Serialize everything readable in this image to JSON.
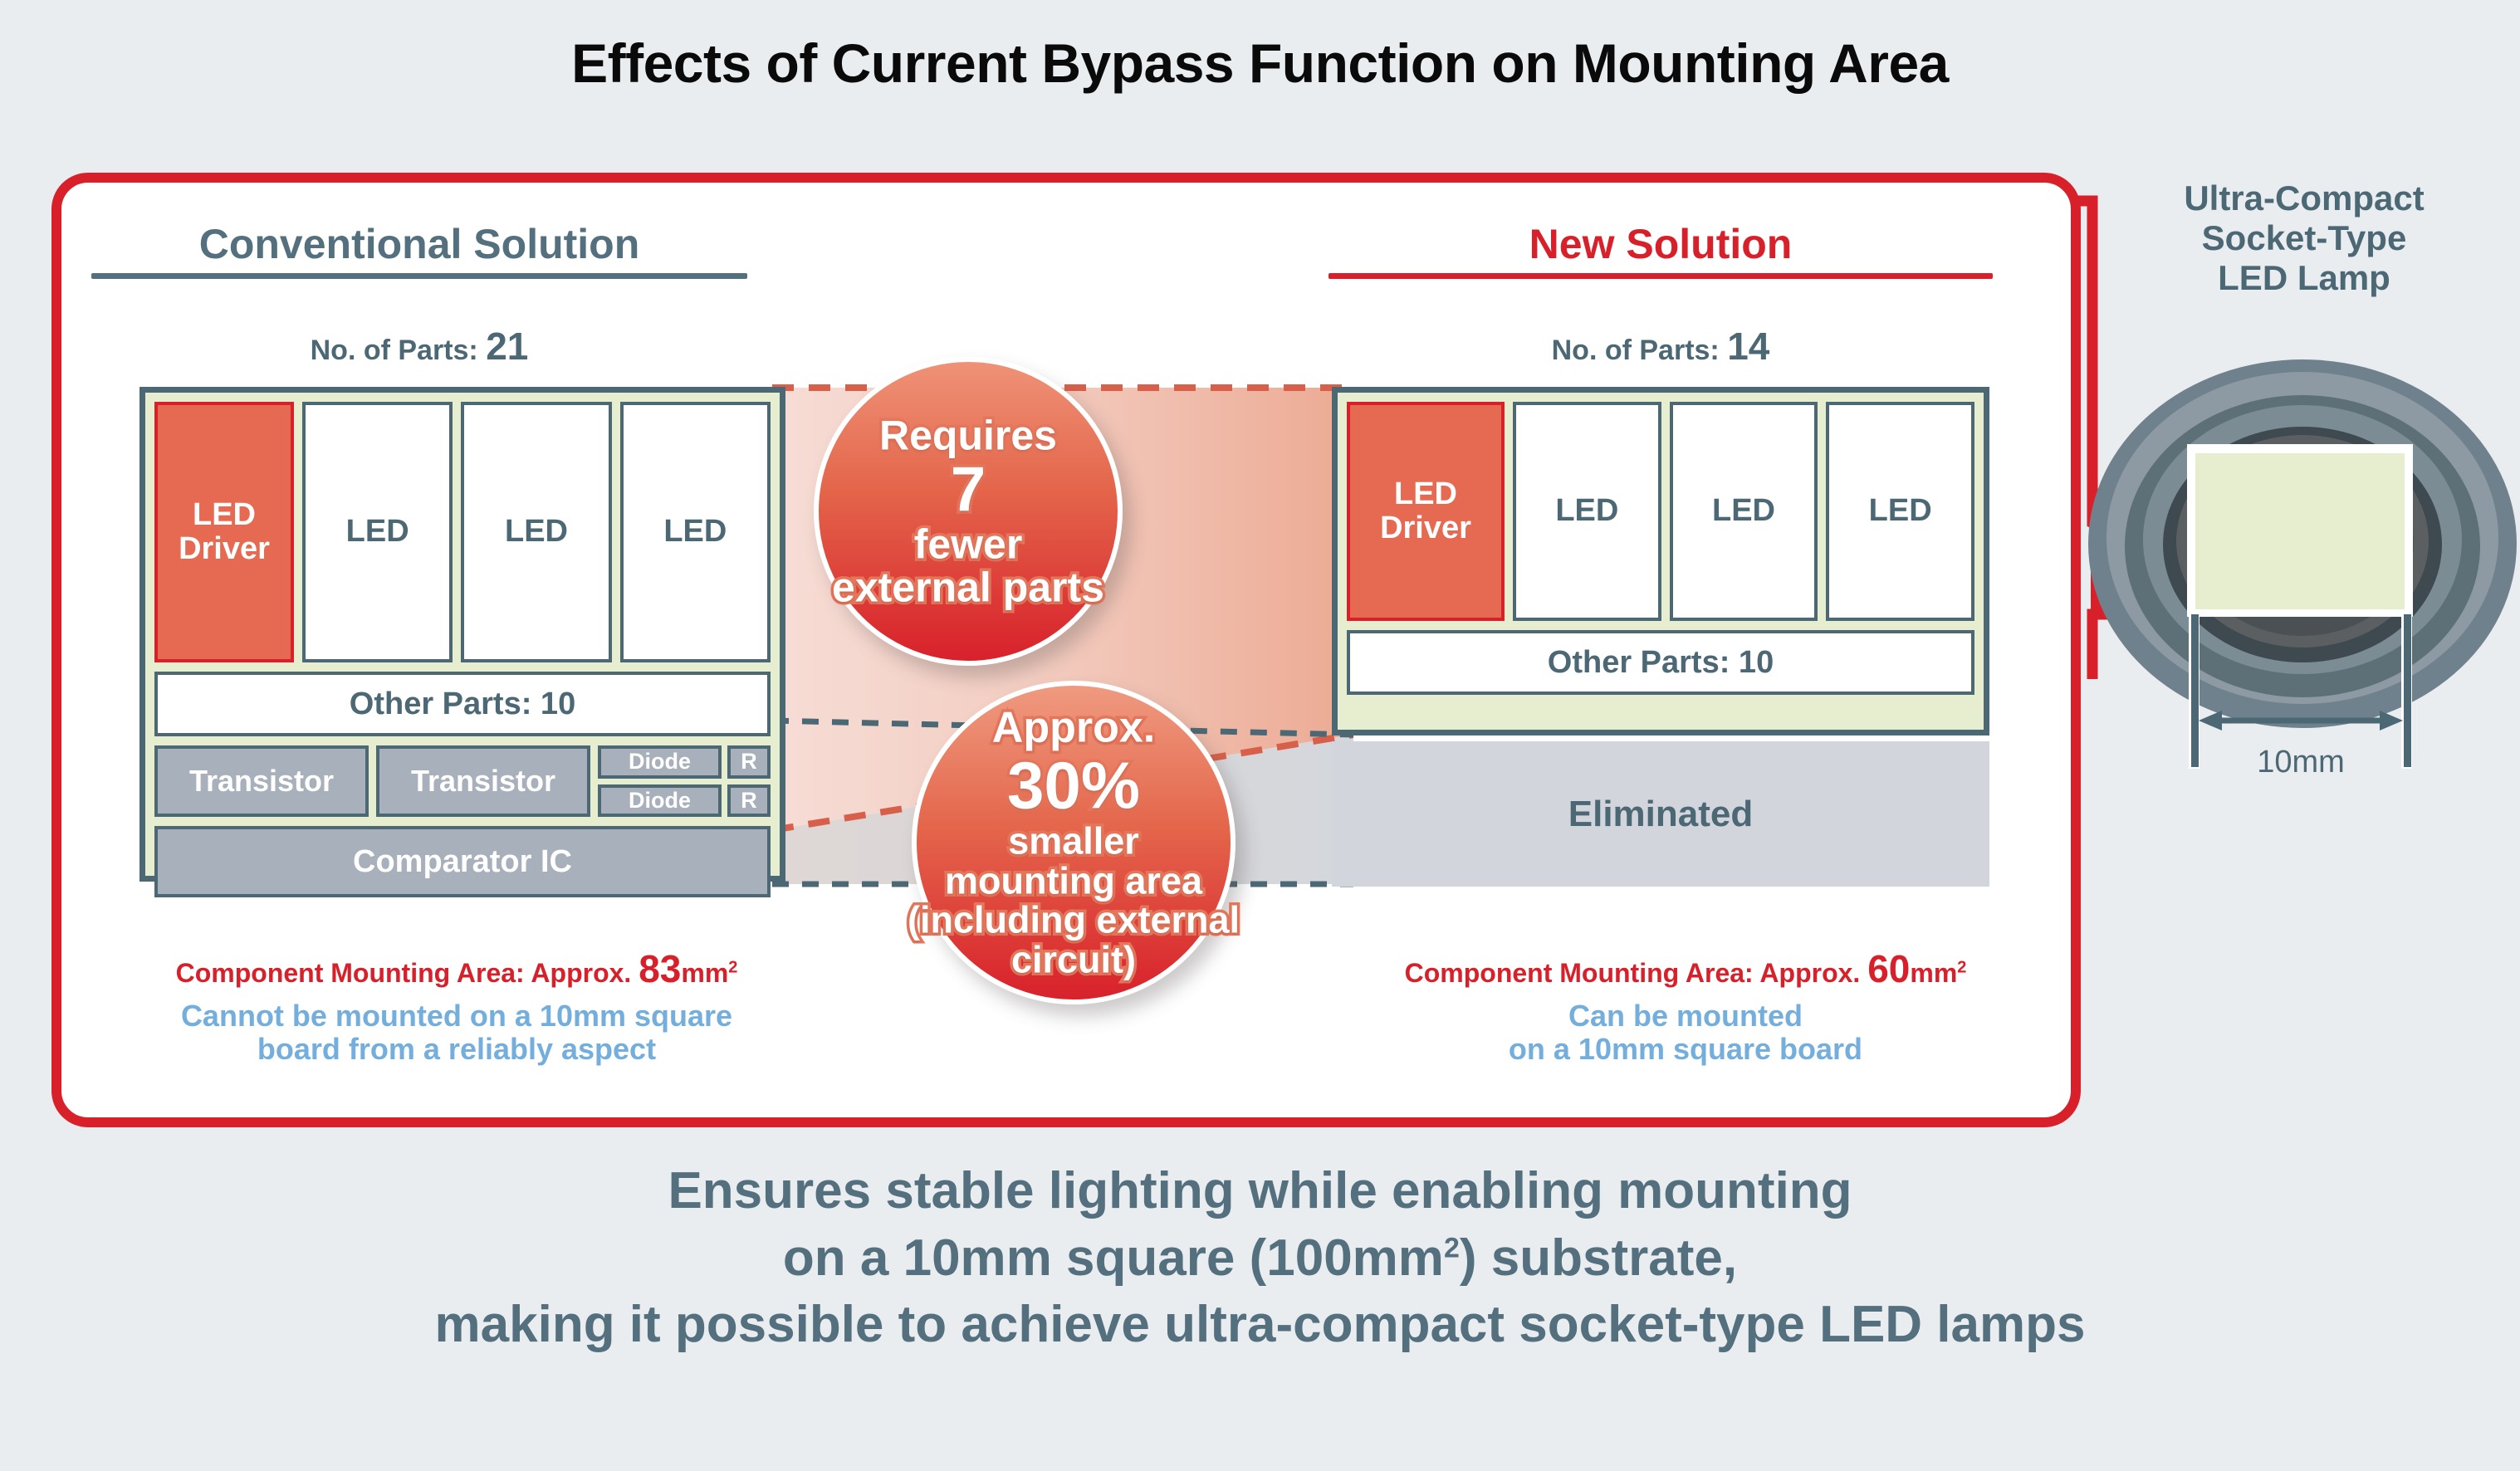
{
  "page_title": "Effects of Current Bypass Function on Mounting Area",
  "colors": {
    "background": "#e9edf0",
    "card_border_red": "#d8202b",
    "slate": "#4d6875",
    "heading_slate": "#54707e",
    "board_green": "#e7eed0",
    "driver_salmon": "#e56a51",
    "part_gray": "#a8b0bb",
    "eliminated_gray": "#d2d6dc",
    "note_blue": "#73aedd"
  },
  "conventional": {
    "heading": "Conventional Solution",
    "parts_label": "No. of Parts: ",
    "parts_count": "21",
    "board": {
      "driver_label": "LED\nDriver",
      "driver_line1": "LED",
      "driver_line2": "Driver",
      "led_labels": [
        "LED",
        "LED",
        "LED"
      ],
      "other_parts": "Other Parts: 10",
      "transistors": [
        "Transistor",
        "Transistor"
      ],
      "diodes": [
        "Diode",
        "Diode"
      ],
      "resistors": [
        "R",
        "R"
      ],
      "comparator": "Comparator IC"
    },
    "area_prefix": "Component Mounting Area: Approx. ",
    "area_value": "83",
    "area_unit": "mm",
    "area_exp": "2",
    "note_line1": "Cannot be mounted on a 10mm square",
    "note_line2": "board from a reliably aspect"
  },
  "new_solution": {
    "heading": "New Solution",
    "parts_label": "No. of Parts: ",
    "parts_count": "14",
    "board": {
      "driver_line1": "LED",
      "driver_line2": "Driver",
      "led_labels": [
        "LED",
        "LED",
        "LED"
      ],
      "other_parts": "Other Parts: 10"
    },
    "eliminated_label": "Eliminated",
    "area_prefix": "Component Mounting Area: Approx. ",
    "area_value": "60",
    "area_unit": "mm",
    "area_exp": "2",
    "note_line1": "Can be mounted",
    "note_line2": "on a 10mm square board"
  },
  "bubbles": {
    "parts_bubble": {
      "line1_text": "Requires ",
      "line1_number": "7",
      "line2": "fewer",
      "line3": "external parts"
    },
    "area_bubble": {
      "line1_text": "Approx. ",
      "line1_percent": "30%",
      "line2": "smaller",
      "line3": "mounting area",
      "line4": "(including external",
      "line5": "circuit)"
    }
  },
  "lamp": {
    "title_line1": "Ultra-Compact",
    "title_line2": "Socket-Type",
    "title_line3": "LED Lamp",
    "dimension_label": "10mm"
  },
  "caption": {
    "line1": "Ensures stable lighting while enabling mounting",
    "line2_a": "on a 10mm square (100mm",
    "line2_exp": "2",
    "line2_b": ") substrate,",
    "line3": "making it possible to achieve ultra-compact socket-type LED lamps"
  }
}
